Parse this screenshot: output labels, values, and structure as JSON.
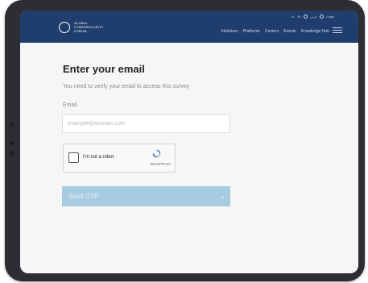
{
  "header": {
    "logo_text": "GLOBAL CYBERSECURITY FORUM",
    "utility": {
      "minus": "A-",
      "plus": "A+",
      "language": "عربي",
      "login": "Login"
    },
    "nav": [
      "Initiatives",
      "Platforms",
      "Centers",
      "Events",
      "Knowledge Hub"
    ]
  },
  "form": {
    "title": "Enter your email",
    "subtitle": "You need to verify your email to access this survey",
    "email_label": "Email",
    "email_placeholder": "example@domain.com",
    "email_value": ""
  },
  "captcha": {
    "checkbox_label": "I'm not a robot",
    "brand": "reCAPTCHA"
  },
  "submit": {
    "label": "Send OTP",
    "arrow": "›"
  },
  "colors": {
    "header_bg": "#1f3e6d",
    "button_bg": "#a7cbe0",
    "screen_bg": "#f6f6f7"
  }
}
